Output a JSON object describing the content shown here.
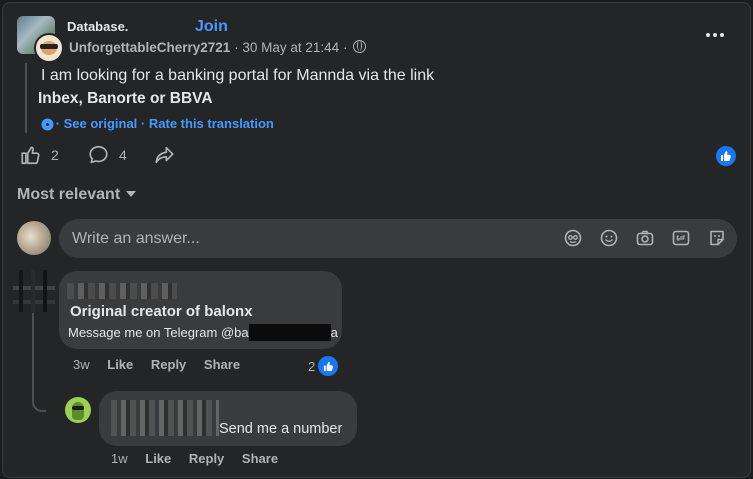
{
  "post": {
    "group_name": "Database.",
    "join_label": "Join",
    "author": "UnforgettableCherry2721",
    "separator": "·",
    "timestamp": "30 May at 21:44",
    "text_line1": "I am looking for a banking portal for Mannda via the link",
    "text_line2": "Inbex, Banorte or BBVA",
    "see_original": "See original",
    "rate_translation": "Rate this translation",
    "likes_count": "2",
    "comments_count": "4",
    "icons": {
      "group_avatar": "group-avatar",
      "privacy": "globe-icon",
      "more": "more-dots-icon",
      "translation": "translate-gear-icon",
      "like": "thumbs-up-icon",
      "comment": "comment-bubble-icon",
      "share": "share-arrow-icon",
      "reaction": "like-reaction-icon"
    }
  },
  "comments_header": {
    "sort_label": "Most relevant"
  },
  "composer": {
    "placeholder": "Write an answer...",
    "icons": [
      "avatar-sticker-icon",
      "emoji-icon",
      "camera-icon",
      "gif-icon",
      "sticker-icon"
    ]
  },
  "comments": [
    {
      "author_redacted": true,
      "title": "Original creator of balonx",
      "body_prefix": "Message me on Telegram @ba",
      "body_suffix": "a",
      "time": "3w",
      "like_label": "Like",
      "reply_label": "Reply",
      "share_label": "Share",
      "reaction_count": "2"
    },
    {
      "author_redacted": true,
      "body": "Send me a number",
      "time": "1w",
      "like_label": "Like",
      "reply_label": "Reply",
      "share_label": "Share"
    }
  ],
  "colors": {
    "background": "#242526",
    "bubble": "#3a3b3c",
    "link_blue": "#4599ff",
    "like_blue": "#1877f2",
    "text_primary": "#e4e6eb",
    "text_secondary": "#b0b3b8"
  }
}
